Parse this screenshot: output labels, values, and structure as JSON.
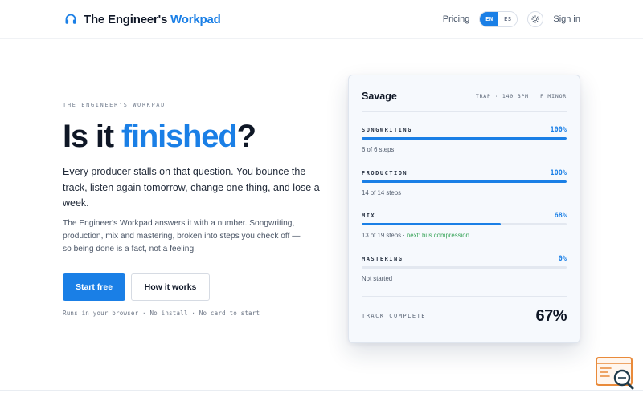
{
  "header": {
    "brand_prefix": "The Engineer's",
    "brand_accent": "Workpad",
    "logo_icon": "headphones-icon",
    "nav": {
      "pricing": "Pricing",
      "lang_en": "EN",
      "lang_es": "ES",
      "theme_icon": "sun-icon",
      "signin": "Sign in"
    }
  },
  "hero": {
    "eyebrow": "THE ENGINEER'S WORKPAD",
    "title_prefix": "Is it ",
    "title_accent": "finished",
    "title_suffix": "?",
    "lead": "Every producer stalls on that question. You bounce the track, listen again tomorrow, change one thing, and lose a week.",
    "sub": "The Engineer's Workpad answers it with a number. Songwriting, production, mix and mastering, broken into steps you check off — so being done is a fact, not a feeling.",
    "cta_primary": "Start free",
    "cta_secondary": "How it works",
    "fineprint": "Runs in your browser · No install · No card to start"
  },
  "card": {
    "title": "Savage",
    "meta": "TRAP · 140 BPM · F MINOR",
    "sections": [
      {
        "label": "SONGWRITING",
        "pct": "100%",
        "progress": 1.0,
        "steps": "6 of 6 steps",
        "next": ""
      },
      {
        "label": "PRODUCTION",
        "pct": "100%",
        "progress": 1.0,
        "steps": "14 of 14 steps",
        "next": ""
      },
      {
        "label": "MIX",
        "pct": "68%",
        "progress": 0.68,
        "steps": "13 of 19 steps · ",
        "next": "next: bus compression"
      },
      {
        "label": "MASTERING",
        "pct": "0%",
        "progress": 0.0,
        "steps": "Not started",
        "next": ""
      }
    ],
    "total_label": "TRACK COMPLETE",
    "total_value": "67%"
  },
  "colors": {
    "accent": "#1a7fe6",
    "next_step": "#3aa55b",
    "widget": "#e98a3a"
  },
  "corner_widget_icon": "search-code-icon"
}
